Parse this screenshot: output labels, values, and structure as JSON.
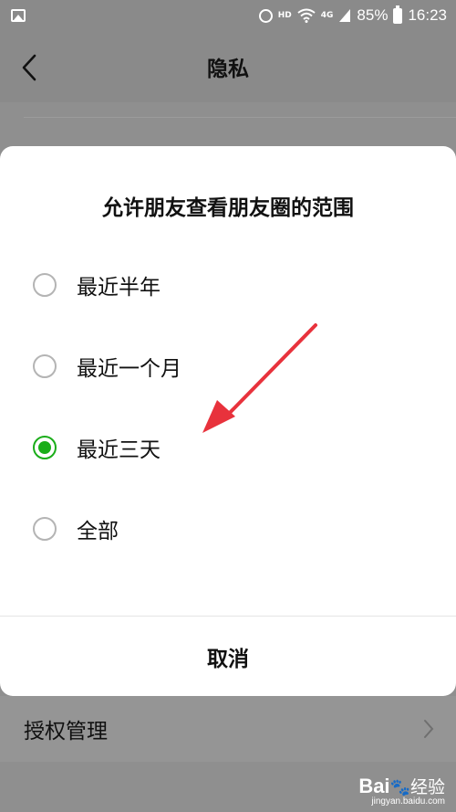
{
  "status_bar": {
    "hd_tag": "HD",
    "network_tag": "4G",
    "battery_percent": "85%",
    "time": "16:23",
    "icons": [
      "gallery-icon",
      "alarm-icon",
      "wifi-icon",
      "signal-icon",
      "battery-icon"
    ]
  },
  "nav": {
    "title": "隐私",
    "back_icon": "chevron-left-icon"
  },
  "background_page": {
    "row_label": "授权管理",
    "row_icon": "chevron-right-icon"
  },
  "dialog": {
    "title": "允许朋友查看朋友圈的范围",
    "options": [
      {
        "label": "最近半年",
        "selected": false
      },
      {
        "label": "最近一个月",
        "selected": false
      },
      {
        "label": "最近三天",
        "selected": true
      },
      {
        "label": "全部",
        "selected": false
      }
    ],
    "cancel_label": "取消"
  },
  "colors": {
    "accent_green": "#1aad19",
    "overlay_gray": "#8f8f8f",
    "annotation_red": "#e8323c"
  },
  "watermark": {
    "logo": "Bai",
    "logo_suffix": "经验",
    "url": "jingyan.baidu.com"
  }
}
